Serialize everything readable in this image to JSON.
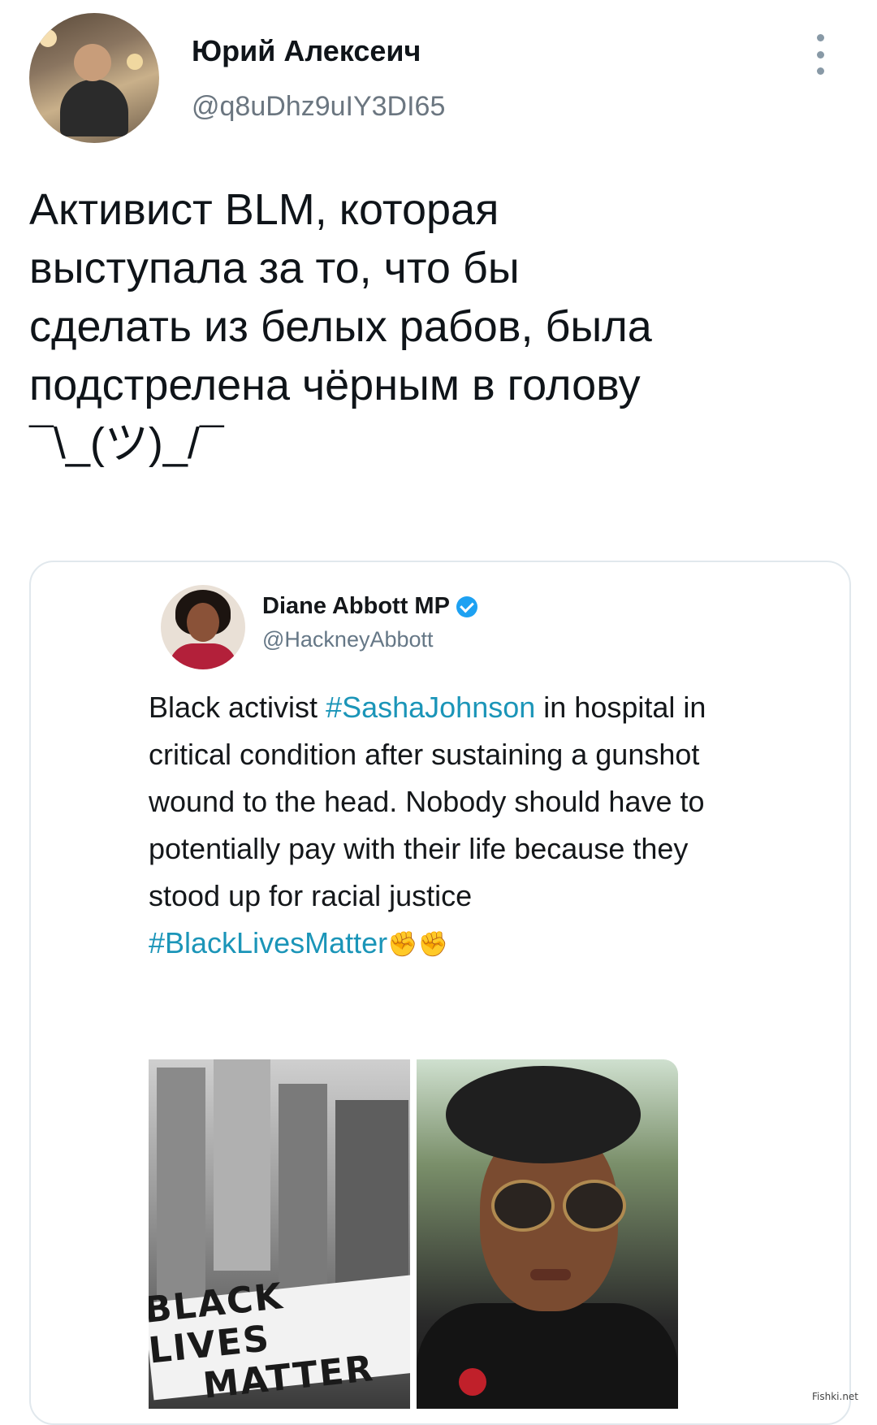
{
  "tweet": {
    "display_name": "Юрий Алексеич",
    "handle": "@q8uDhz9uIY3DI65",
    "text": "Активист BLM, которая\nвыступала за то, что бы\nсделать из белых рабов, была\nподстрелена чёрным в голову\n¯\\_(ツ)_/¯"
  },
  "quoted": {
    "display_name": "Diane Abbott MP",
    "handle": "@HackneyAbbott",
    "text_part1": "Black activist ",
    "hashtag1": "#SashaJohnson",
    "text_part2": " in hospital in critical condition after sustaining a gunshot wound to the head. Nobody should have to potentially pay with their life because they stood up for racial justice ",
    "hashtag2": "#BlackLivesMatter",
    "emoji_icon": "raised-fist-icon",
    "banner_line1": "BLACK LIVES",
    "banner_line2": "MATTER"
  },
  "watermark": "Fishki.net",
  "colors": {
    "hashtag": "#1b95b8",
    "verified": "#1da1f2",
    "handle": "#6b7680"
  }
}
